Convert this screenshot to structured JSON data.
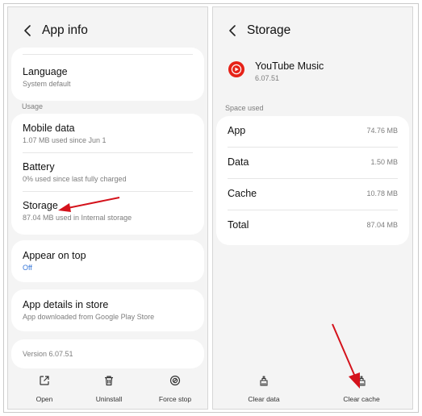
{
  "app_info": {
    "back_label": "<",
    "title": "App info",
    "items": [
      {
        "primary": "Language",
        "secondary": "System default"
      },
      {
        "primary": "Mobile data",
        "secondary": "1.07 MB used since Jun 1"
      },
      {
        "primary": "Battery",
        "secondary": "0% used since last fully charged"
      },
      {
        "primary": "Storage",
        "secondary": "87.04 MB used in Internal storage"
      },
      {
        "primary": "Appear on top",
        "secondary": "Off"
      },
      {
        "primary": "App details in store",
        "secondary": "App downloaded from Google Play Store"
      }
    ],
    "usage_label": "Usage",
    "version": "Version 6.07.51",
    "bottom_actions": [
      {
        "label": "Open",
        "icon": "open-external-icon"
      },
      {
        "label": "Uninstall",
        "icon": "trash-icon"
      },
      {
        "label": "Force stop",
        "icon": "force-stop-icon"
      }
    ]
  },
  "storage": {
    "title": "Storage",
    "app_name": "YouTube Music",
    "app_version": "6.07.51",
    "space_used_label": "Space used",
    "rows": [
      {
        "label": "App",
        "value": "74.76 MB"
      },
      {
        "label": "Data",
        "value": "1.50 MB"
      },
      {
        "label": "Cache",
        "value": "10.78 MB"
      },
      {
        "label": "Total",
        "value": "87.04 MB"
      }
    ],
    "bottom_actions": [
      {
        "label": "Clear data",
        "icon": "clear-data-icon"
      },
      {
        "label": "Clear cache",
        "icon": "clear-cache-icon"
      }
    ]
  },
  "colors": {
    "accent_blue": "#3777d8",
    "annotation_red": "#d4121b",
    "youtube_red": "#e62117"
  }
}
